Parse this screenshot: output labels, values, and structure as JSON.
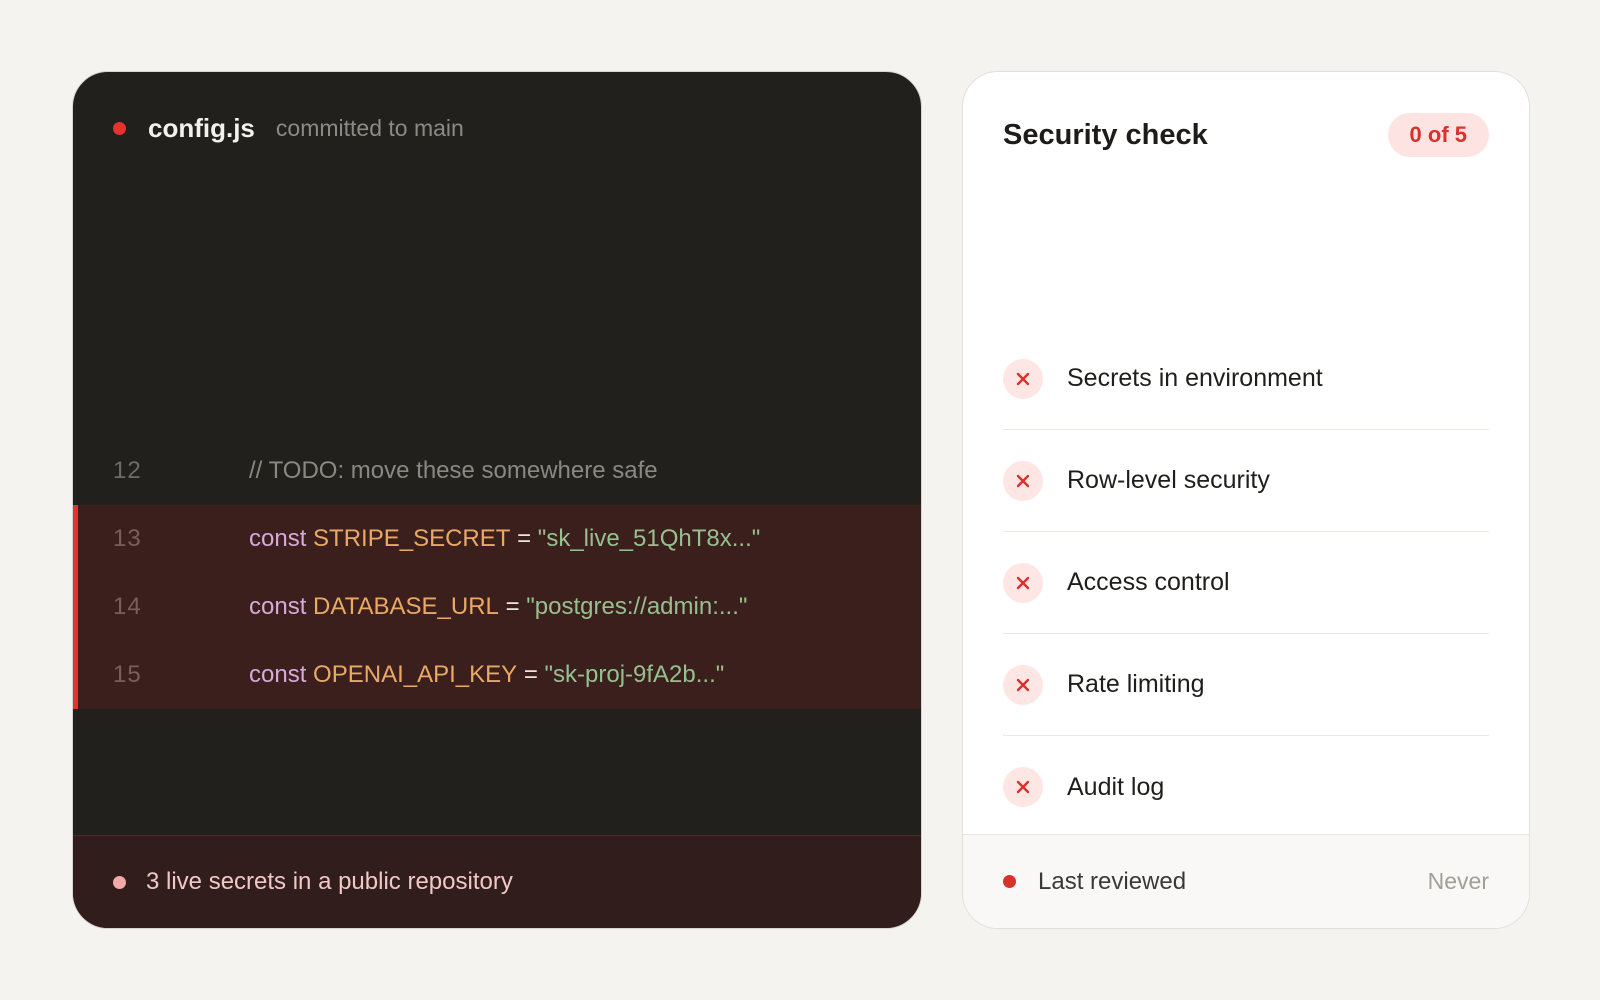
{
  "colors": {
    "background": "#f4f3f0",
    "code_bg": "#21201d",
    "flag_bg": "#3b1f1d",
    "flag_bar": "#e5322d",
    "keyword": "#d7a9d9",
    "variable": "#e9a965",
    "string": "#97c08e",
    "danger": "#d9312b"
  },
  "code_panel": {
    "file_name": "config.js",
    "file_meta": "committed to main",
    "status_icon": "red-dot",
    "comment_line": {
      "number": "12",
      "text": "// TODO: move these somewhere safe"
    },
    "lines": [
      {
        "number": "13",
        "keyword": "const",
        "name": "STRIPE_SECRET",
        "op": "=",
        "value": "\"sk_live_51QhT8x...\""
      },
      {
        "number": "14",
        "keyword": "const",
        "name": "DATABASE_URL",
        "op": "=",
        "value": "\"postgres://admin:...\""
      },
      {
        "number": "15",
        "keyword": "const",
        "name": "OPENAI_API_KEY",
        "op": "=",
        "value": "\"sk-proj-9fA2b...\""
      }
    ],
    "footer_text": "3 live secrets in a public repository"
  },
  "security_panel": {
    "title": "Security check",
    "badge": "0 of 5",
    "checks": [
      {
        "label": "Secrets in environment",
        "status": "fail",
        "icon": "x-icon"
      },
      {
        "label": "Row-level security",
        "status": "fail",
        "icon": "x-icon"
      },
      {
        "label": "Access control",
        "status": "fail",
        "icon": "x-icon"
      },
      {
        "label": "Rate limiting",
        "status": "fail",
        "icon": "x-icon"
      },
      {
        "label": "Audit log",
        "status": "fail",
        "icon": "x-icon"
      }
    ],
    "footer": {
      "label": "Last reviewed",
      "value": "Never"
    }
  }
}
